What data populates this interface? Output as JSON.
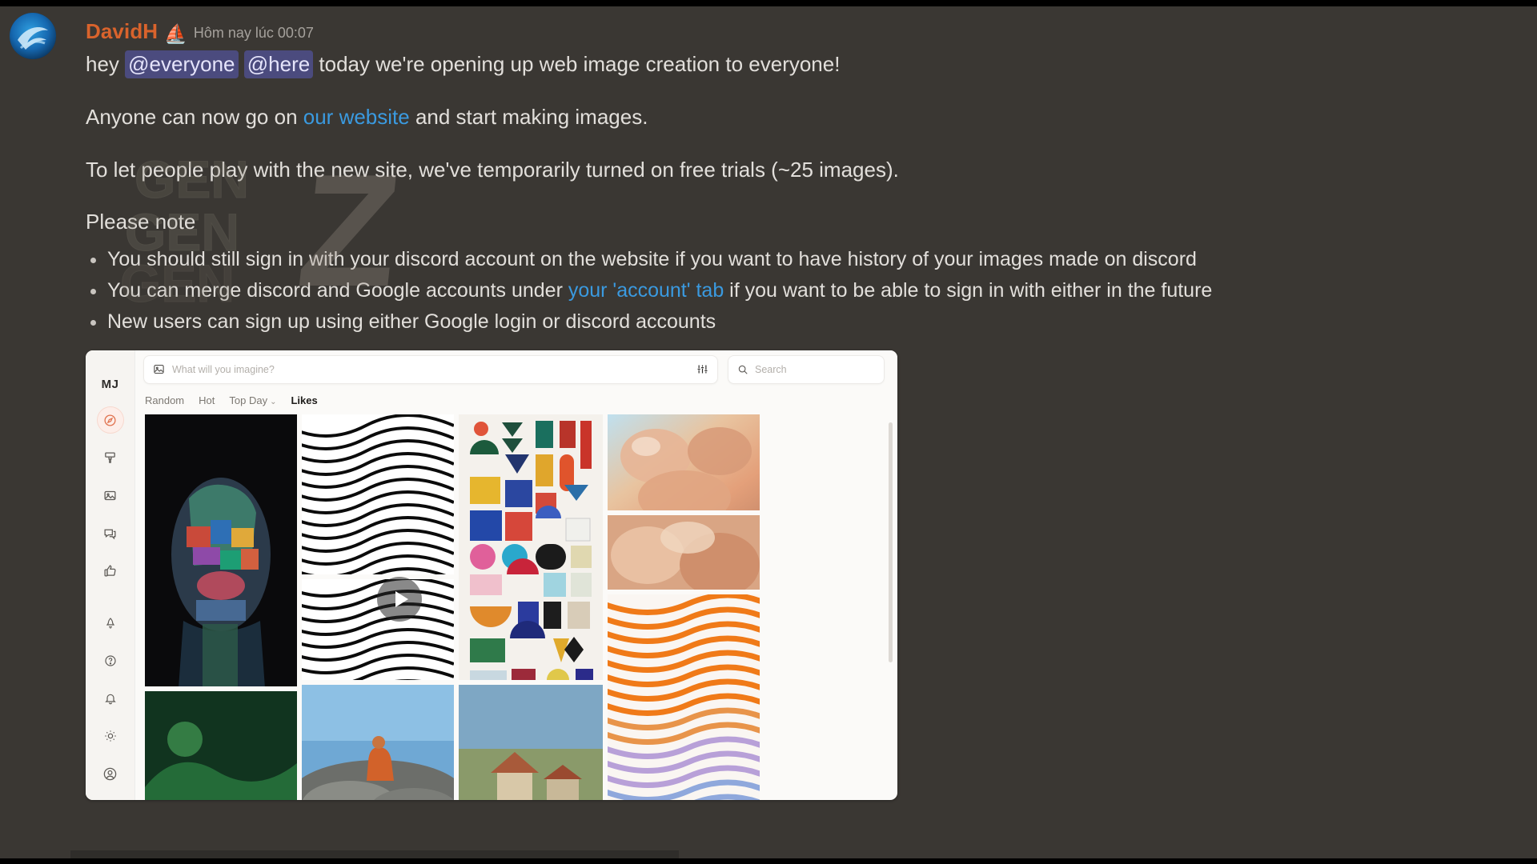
{
  "message": {
    "author": "DavidH",
    "author_emoji": "⛵",
    "timestamp": "Hôm nay lúc 00:07",
    "line1_pre": "hey ",
    "mention_everyone": "@everyone",
    "mention_here": "@here",
    "line1_post": " today we're opening up web image creation to everyone!",
    "line2_pre": "Anyone can now go on ",
    "line2_link": "our website",
    "line2_post": " and start making images.",
    "line3": "To let people play with the new site, we've temporarily turned on free trials (~25 images).",
    "note_title": "Please note",
    "notes": [
      {
        "pre": "You should still sign in with your discord account on the website if you want to have history of your images made on discord",
        "link": "",
        "post": ""
      },
      {
        "pre": "You can merge discord and Google accounts under ",
        "link": "your 'account' tab",
        "post": " if you want to be able to sign in with either in the future"
      },
      {
        "pre": "New users can sign up using either Google login or discord accounts",
        "link": "",
        "post": ""
      }
    ]
  },
  "embed": {
    "logo": "MJ",
    "imagine_placeholder": "What will you imagine?",
    "search_placeholder": "Search",
    "tabs": [
      {
        "label": "Random",
        "active": false,
        "caret": ""
      },
      {
        "label": "Hot",
        "active": false,
        "caret": ""
      },
      {
        "label": "Top Day",
        "active": false,
        "caret": "⌄"
      },
      {
        "label": "Likes",
        "active": true,
        "caret": ""
      }
    ],
    "rail_icons": [
      "explore-icon",
      "brush-icon",
      "gallery-icon",
      "chat-icon",
      "thumbs-up-icon"
    ],
    "rail_bottom_icons": [
      "rocket-icon",
      "help-icon",
      "bell-icon",
      "theme-icon",
      "account-icon"
    ]
  },
  "watermark": {
    "text_a": "GEN",
    "text_b": "GEN",
    "text_c": "GEN",
    "letter_z": "Z"
  },
  "colors": {
    "username": "#d9632c",
    "link": "#3a9ae0",
    "mention_bg": "#4b4b7e",
    "message_bg": "#3a3733",
    "accent": "#e0714d"
  }
}
